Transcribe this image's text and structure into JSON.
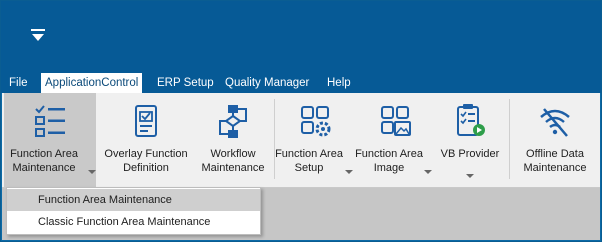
{
  "menu": {
    "items": [
      "File",
      "ApplicationControl",
      "ERP Setup",
      "Quality Manager",
      "Help"
    ]
  },
  "ribbon": {
    "function_area_maintenance": "Function Area Maintenance",
    "overlay_function_definition": "Overlay Function Definition",
    "workflow_maintenance": "Workflow Maintenance",
    "function_area_setup": "Function Area Setup",
    "function_area_image": "Function Area Image",
    "vb_provider": "VB Provider",
    "offline_data_maintenance": "Offline Data Maintenance"
  },
  "dropdown": {
    "items": [
      "Function Area Maintenance",
      "Classic Function Area Maintenance"
    ]
  },
  "colors": {
    "accent": "#065a96",
    "icon": "#1e5fa6"
  }
}
